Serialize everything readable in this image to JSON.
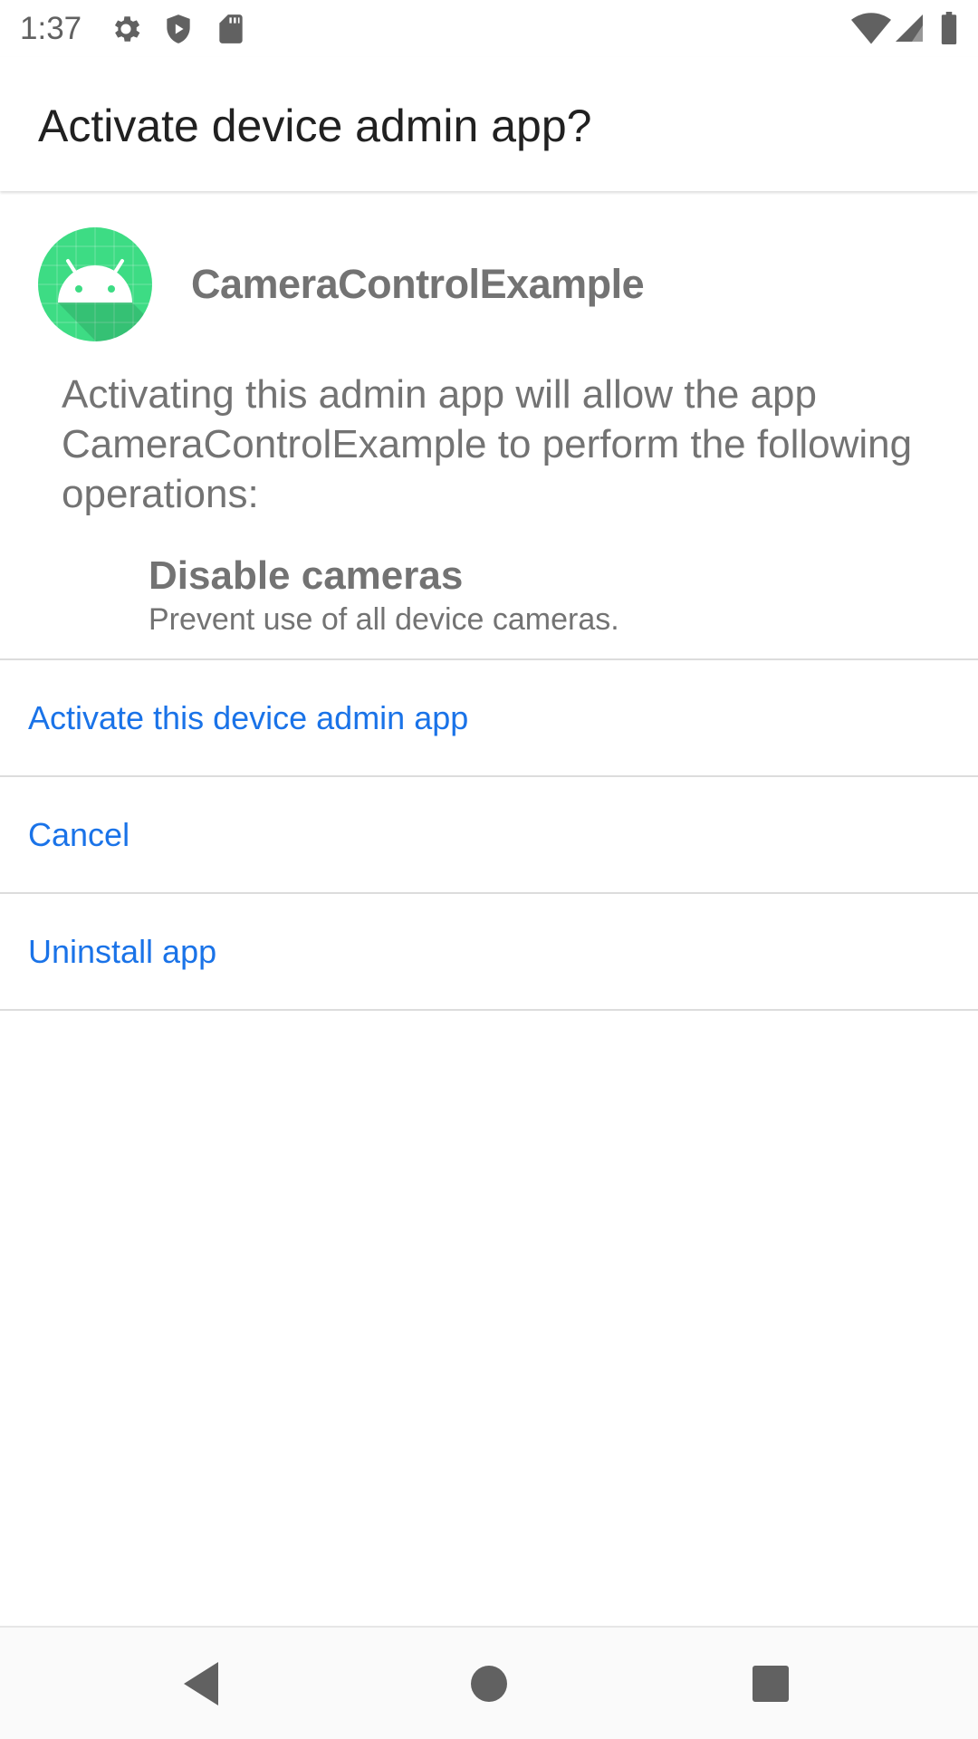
{
  "status_bar": {
    "time": "1:37",
    "left_icons": [
      "gear-icon",
      "shield-icon",
      "sd-card-icon"
    ],
    "right_icons": [
      "wifi-icon",
      "cellular-signal-icon",
      "battery-icon"
    ]
  },
  "app_bar": {
    "title": "Activate device admin app?"
  },
  "app": {
    "icon": "android-app-icon",
    "icon_color": "#3ddc84",
    "name": "CameraControlExample"
  },
  "description": "Activating this admin app will allow the app CameraControlExample to perform the following operations:",
  "policy": {
    "title": "Disable cameras",
    "description": "Prevent use of all device cameras."
  },
  "actions": [
    {
      "label": "Activate this device admin app"
    },
    {
      "label": "Cancel"
    },
    {
      "label": "Uninstall app"
    }
  ],
  "nav_bar": {
    "buttons": [
      "back-icon",
      "home-icon",
      "recents-icon"
    ]
  },
  "colors": {
    "accent": "#1a73e8",
    "secondary_text": "#737373"
  }
}
